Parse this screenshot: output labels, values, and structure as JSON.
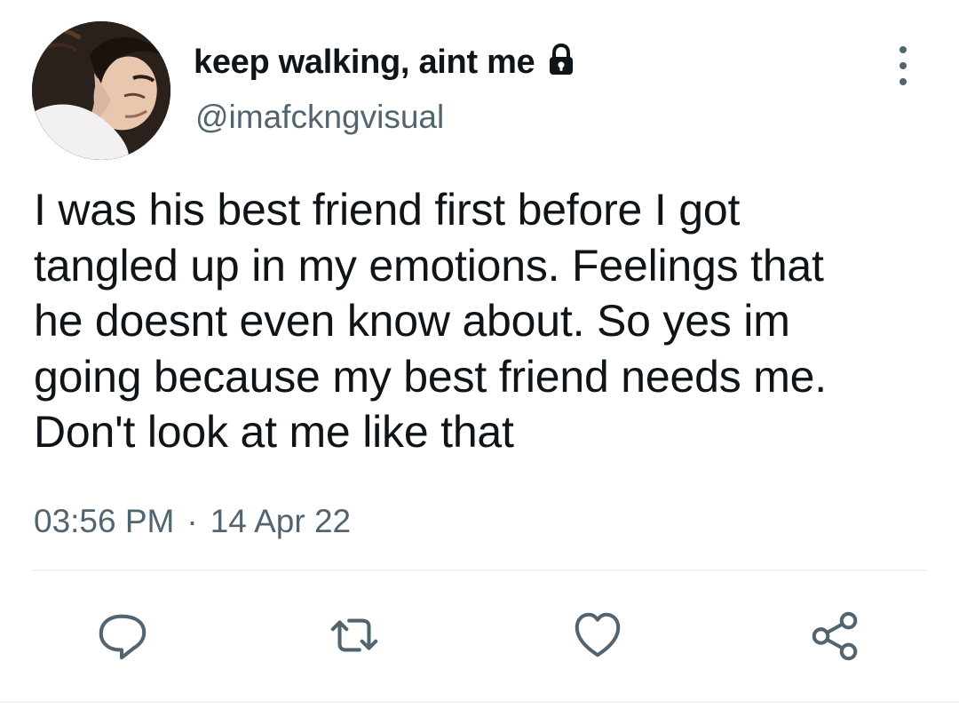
{
  "user": {
    "display_name": "keep walking, aint me",
    "handle": "@imafckngvisual",
    "protected_icon": "lock-icon",
    "avatar": "profile-photo"
  },
  "tweet": {
    "text": "I was his best friend first before I got\ntangled up in my emotions. Feelings that\nhe doesnt even know about. So yes im\ngoing because my best friend needs me.\nDon't look at me like that",
    "time": "03:56 PM",
    "separator": "·",
    "date": "14 Apr 22"
  },
  "actions": {
    "items": [
      "reply-icon",
      "retweet-icon",
      "heart-icon",
      "share-icon"
    ]
  },
  "colors": {
    "text": "#0f1419",
    "secondary": "#536471",
    "divider": "#eff3f4"
  }
}
